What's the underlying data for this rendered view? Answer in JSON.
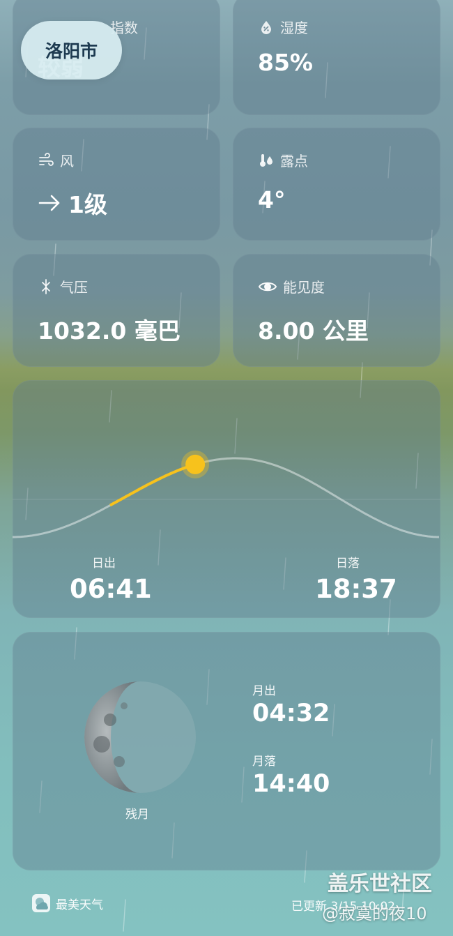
{
  "city": "洛阳市",
  "tiles": {
    "index": {
      "label": "指数",
      "value": "较弱"
    },
    "humidity": {
      "label": "湿度",
      "value": "85%",
      "icon": "humidity-drop-icon"
    },
    "wind": {
      "label": "风",
      "value": "1级",
      "icon": "wind-icon",
      "direction_icon": "arrow-right-icon"
    },
    "dewpoint": {
      "label": "露点",
      "value": "4°",
      "icon": "thermometer-drop-icon"
    },
    "pressure": {
      "label": "气压",
      "value": "1032.0 毫巴",
      "icon": "pressure-icon"
    },
    "visibility": {
      "label": "能见度",
      "value": "8.00 公里",
      "icon": "eye-icon"
    }
  },
  "sun": {
    "sunrise_label": "日出",
    "sunrise_time": "06:41",
    "sunset_label": "日落",
    "sunset_time": "18:37",
    "progress": 0.37,
    "sun_color": "#f7c21c"
  },
  "moon": {
    "phase_label": "残月",
    "moonrise_label": "月出",
    "moonrise_time": "04:32",
    "moonset_label": "月落",
    "moonset_time": "14:40"
  },
  "footer": {
    "app_name": "最美天气",
    "updated_text": "已更新 3/15 10:02"
  },
  "watermark": {
    "line1": "盖乐世社区",
    "line2": "@寂寞的夜10"
  }
}
